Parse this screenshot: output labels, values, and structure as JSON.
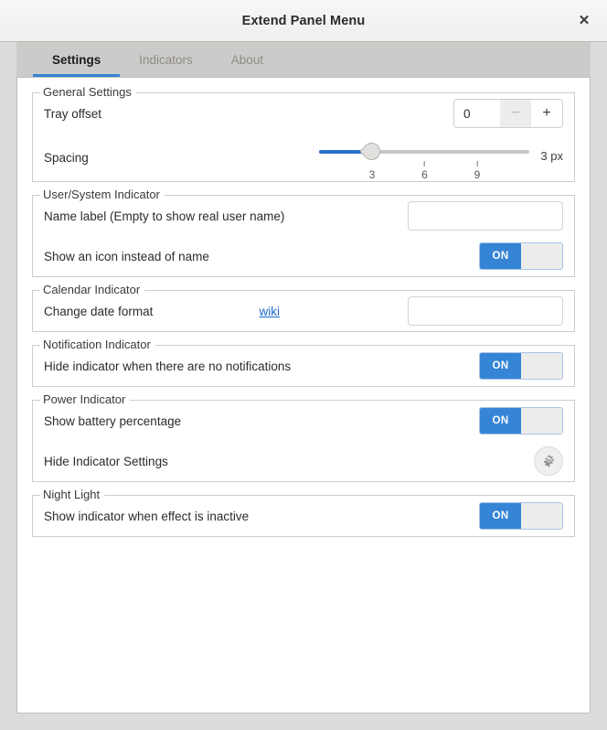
{
  "window": {
    "title": "Extend Panel Menu",
    "close_icon": "close-icon"
  },
  "tabs": [
    {
      "label": "Settings",
      "active": true
    },
    {
      "label": "Indicators",
      "active": false
    },
    {
      "label": "About",
      "active": false
    }
  ],
  "sections": {
    "general": {
      "legend": "General Settings",
      "tray_offset": {
        "label": "Tray offset",
        "value": "0",
        "minus_label": "−",
        "plus_label": "+"
      },
      "spacing": {
        "label": "Spacing",
        "value": 3,
        "min": 0,
        "max": 12,
        "unit_label": "3 px",
        "marks": [
          {
            "label": "3",
            "value": 3
          },
          {
            "label": "6",
            "value": 6
          },
          {
            "label": "9",
            "value": 9
          }
        ]
      }
    },
    "user_system": {
      "legend": "User/System Indicator",
      "name_label": {
        "label": "Name label (Empty to show real user name)",
        "value": "",
        "placeholder": ""
      },
      "show_icon": {
        "label": "Show an icon instead of name",
        "state": "ON"
      }
    },
    "calendar": {
      "legend": "Calendar Indicator",
      "date_format": {
        "label": "Change date format",
        "link_text": "wiki",
        "value": "",
        "placeholder": ""
      }
    },
    "notification": {
      "legend": "Notification Indicator",
      "hide_indicator": {
        "label": "Hide indicator when there are no notifications",
        "state": "ON"
      }
    },
    "power": {
      "legend": "Power Indicator",
      "battery_percentage": {
        "label": "Show battery percentage",
        "state": "ON"
      },
      "hide_indicator_settings": {
        "label": "Hide Indicator Settings",
        "icon": "gear-icon"
      }
    },
    "night_light": {
      "legend": "Night Light",
      "show_indicator": {
        "label": "Show indicator when effect is inactive",
        "state": "ON"
      }
    }
  },
  "colors": {
    "accent": "#3584d6",
    "link": "#1b6acb",
    "slider_fill": "#2a6fc9"
  }
}
